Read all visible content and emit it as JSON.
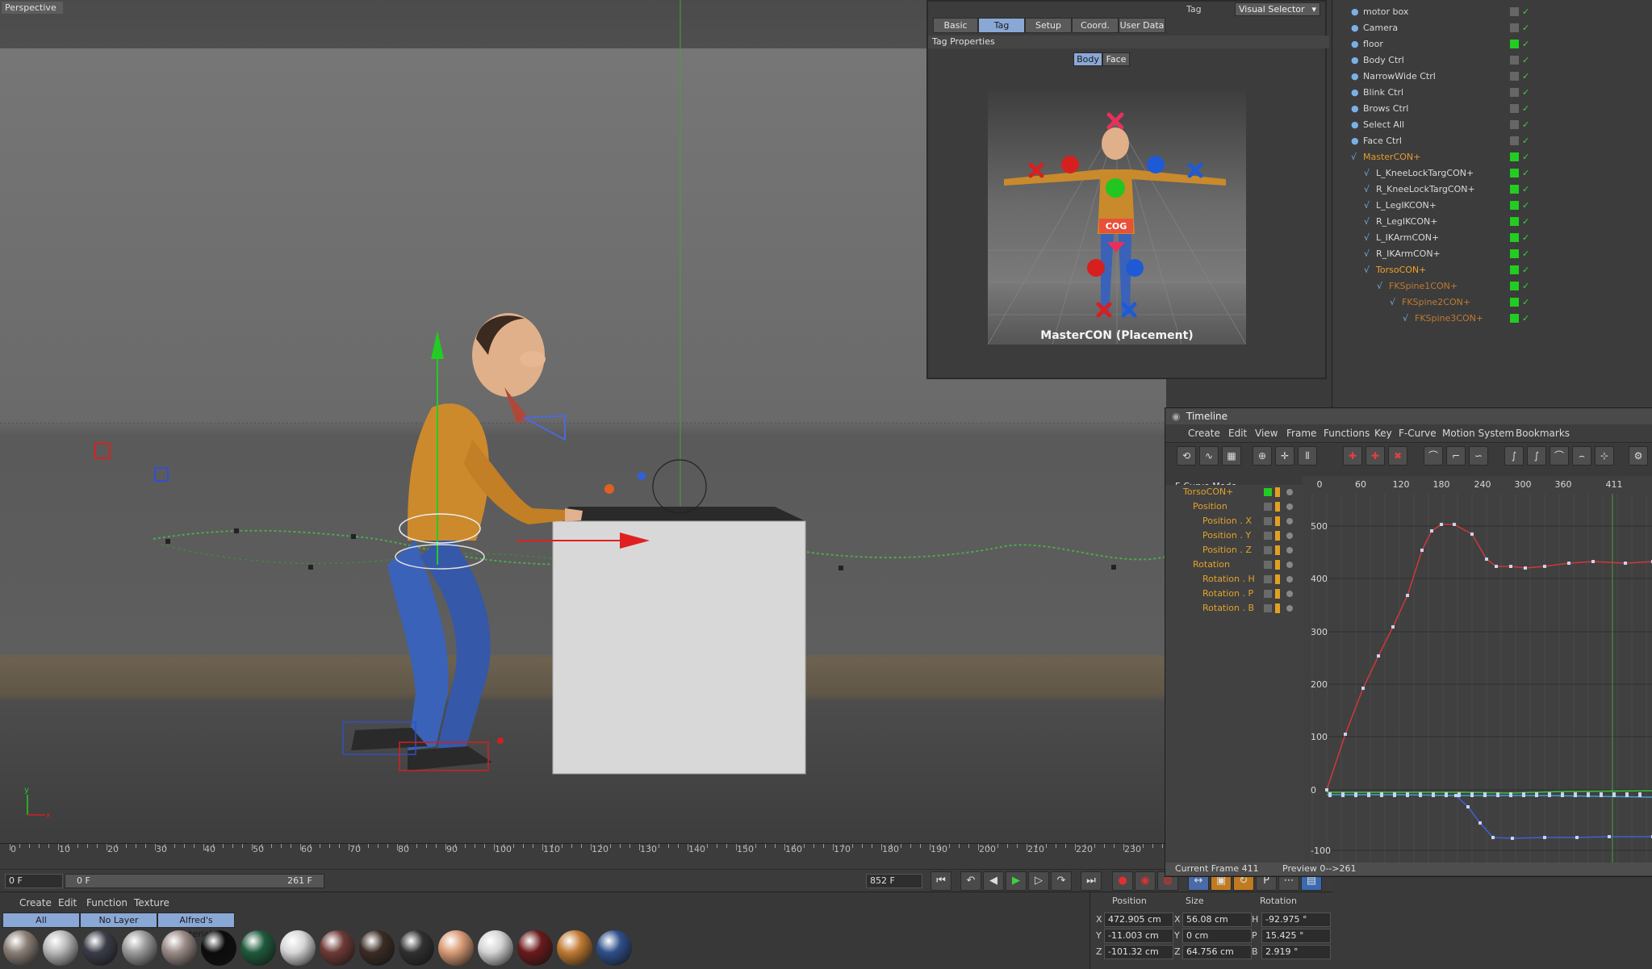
{
  "viewport": {
    "label": "Perspective",
    "axis_labels": {
      "x": "x",
      "y": "y"
    }
  },
  "ruler": {
    "ticks": [
      "0",
      "10",
      "20",
      "30",
      "40",
      "50",
      "60",
      "70",
      "80",
      "90",
      "100",
      "110",
      "120",
      "130",
      "140",
      "150",
      "160",
      "170",
      "180",
      "190",
      "200",
      "210",
      "220",
      "230"
    ]
  },
  "transport": {
    "current_frame": "0 F",
    "range_start": "0 F",
    "range_end": "261 F",
    "max_frame": "852 F"
  },
  "material_manager": {
    "menus": [
      "Create",
      "Edit",
      "Function",
      "Texture"
    ],
    "tabs": [
      "All",
      "No Layer",
      "Alfred's Materials"
    ],
    "material_colors": [
      "#8a7f76",
      "#b8b8b8",
      "#3a3d48",
      "#9a9a9a",
      "#9a8a86",
      "#0c0c0c",
      "#1e5a3c",
      "#d6d6d6",
      "#6d3a36",
      "#3a2c24",
      "#303030",
      "#d89a74",
      "#d4d4d4",
      "#6a1a1a",
      "#c07a32",
      "#2e4f8a"
    ]
  },
  "coordinates": {
    "headers": [
      "Position",
      "Size",
      "Rotation"
    ],
    "rows": [
      {
        "axis": "X",
        "position": "472.905 cm",
        "size_axis": "X",
        "size": "56.08 cm",
        "rot_axis": "H",
        "rotation": "-92.975 °"
      },
      {
        "axis": "Y",
        "position": "-11.003 cm",
        "size_axis": "Y",
        "size": "0 cm",
        "rot_axis": "P",
        "rotation": "15.425 °"
      },
      {
        "axis": "Z",
        "position": "-101.32 cm",
        "size_axis": "Z",
        "size": "64.756 cm",
        "rot_axis": "B",
        "rotation": "2.919 °"
      }
    ]
  },
  "attributes": {
    "tag_label": "Tag",
    "tag_dropdown": "Visual Selector",
    "tabs": [
      "Basic",
      "Tag",
      "Setup",
      "Coord.",
      "User Data"
    ],
    "active_tab": "Tag",
    "section": "Tag Properties",
    "mode_buttons": [
      "Body",
      "Face"
    ],
    "cog_label": "COG",
    "caption": "MasterCON (Placement)"
  },
  "object_manager": {
    "rows": [
      {
        "name": "motor box",
        "color": "#d8d8d8"
      },
      {
        "name": "Camera",
        "color": "#d8d8d8"
      },
      {
        "name": "floor",
        "color": "#d8d8d8"
      },
      {
        "name": "Body Ctrl",
        "color": "#d8d8d8"
      },
      {
        "name": "NarrowWide Ctrl",
        "color": "#d8d8d8"
      },
      {
        "name": "Blink Ctrl",
        "color": "#d8d8d8"
      },
      {
        "name": "Brows Ctrl",
        "color": "#d8d8d8"
      },
      {
        "name": "Select All",
        "color": "#d8d8d8"
      },
      {
        "name": "Face Ctrl",
        "color": "#d8d8d8"
      },
      {
        "name": "MasterCON+",
        "color": "#e39a30"
      },
      {
        "name": "L_KneeLockTargCON+",
        "color": "#d8d8d8"
      },
      {
        "name": "R_KneeLockTargCON+",
        "color": "#d8d8d8"
      },
      {
        "name": "L_LegIKCON+",
        "color": "#d8d8d8"
      },
      {
        "name": "R_LegIKCON+",
        "color": "#d8d8d8"
      },
      {
        "name": "L_IKArmCON+",
        "color": "#d8d8d8"
      },
      {
        "name": "R_IKArmCON+",
        "color": "#d8d8d8"
      },
      {
        "name": "TorsoCON+",
        "color": "#f0a030"
      },
      {
        "name": "FKSpine1CON+",
        "color": "#c07a30"
      },
      {
        "name": "FKSpine2CON+",
        "color": "#c07a30"
      },
      {
        "name": "FKSpine3CON+",
        "color": "#c07a30"
      }
    ]
  },
  "timeline": {
    "title": "Timeline",
    "menus": [
      "Create",
      "Edit",
      "View",
      "Frame",
      "Functions",
      "Key",
      "F-Curve",
      "Motion System",
      "Bookmarks"
    ],
    "mode": "F-Curve Mode",
    "tree": [
      {
        "name": "TorsoCON+"
      },
      {
        "name": "Position"
      },
      {
        "name": "Position . X"
      },
      {
        "name": "Position . Y"
      },
      {
        "name": "Position . Z"
      },
      {
        "name": "Rotation"
      },
      {
        "name": "Rotation . H"
      },
      {
        "name": "Rotation . P"
      },
      {
        "name": "Rotation . B"
      }
    ],
    "x_ticks": [
      "0",
      "60",
      "120",
      "180",
      "240",
      "300",
      "360",
      "411"
    ],
    "y_ticks": [
      "500",
      "400",
      "300",
      "200",
      "100",
      "0",
      "-100"
    ],
    "status_frame": "Current Frame  411",
    "status_preview": "Preview  0-->261"
  }
}
